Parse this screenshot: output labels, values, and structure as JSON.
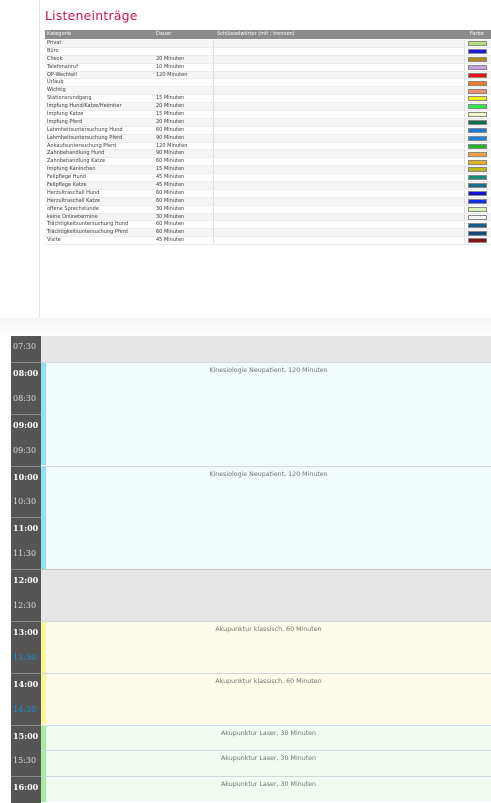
{
  "list": {
    "title": "Listeneinträge",
    "headers": {
      "kategorie": "Kategorie",
      "dauer": "Dauer",
      "schluessel": "Schlüsselwörter (mit ; trennen)",
      "farbe": "Farbe"
    },
    "rows": [
      {
        "kategorie": "Privat",
        "dauer": "",
        "color": "#b5e07a"
      },
      {
        "kategorie": "Büro",
        "dauer": "",
        "color": "#1a1ad8"
      },
      {
        "kategorie": "Check",
        "dauer": "20 Minuten",
        "color": "#b08a1a"
      },
      {
        "kategorie": "Telefonanruf",
        "dauer": "10 Minuten",
        "color": "#c9a0e6"
      },
      {
        "kategorie": "OP-Wechtell",
        "dauer": "120 Minuten",
        "color": "#ee1111"
      },
      {
        "kategorie": "Urlaub",
        "dauer": "",
        "color": "#f07a2a"
      },
      {
        "kategorie": "Wichtig",
        "dauer": "",
        "color": "#f28c6a"
      },
      {
        "kategorie": "Stationsrundgang",
        "dauer": "15 Minuten",
        "color": "#f6ee1a"
      },
      {
        "kategorie": "Impfung Hund/Katze/Heimtier",
        "dauer": "20 Minuten",
        "color": "#29e84a"
      },
      {
        "kategorie": "Impfung Katze",
        "dauer": "15 Minuten",
        "color": "#fafac8"
      },
      {
        "kategorie": "Impfung Pferd",
        "dauer": "20 Minuten",
        "color": "#0e6e4a"
      },
      {
        "kategorie": "Lahmheitsuntersuchung Hund",
        "dauer": "60 Minuten",
        "color": "#1a7ad8"
      },
      {
        "kategorie": "Lahmheitsuntersuchung Pferd",
        "dauer": "90 Minuten",
        "color": "#1a82e0"
      },
      {
        "kategorie": "Ankaufsuntersuchung Pferd",
        "dauer": "120 Minuten",
        "color": "#1ab82a"
      },
      {
        "kategorie": "Zahnbehandlung Hund",
        "dauer": "90 Minuten",
        "color": "#f2a040"
      },
      {
        "kategorie": "Zahnbehandlung Katze",
        "dauer": "60 Minuten",
        "color": "#e2b01a"
      },
      {
        "kategorie": "Impfung Kaninchen",
        "dauer": "15 Minuten",
        "color": "#c2b81a"
      },
      {
        "kategorie": "Fellpflege Hund",
        "dauer": "45 Minuten",
        "color": "#1a8a7a"
      },
      {
        "kategorie": "Fellpflege Katze",
        "dauer": "45 Minuten",
        "color": "#1a6e8a"
      },
      {
        "kategorie": "Herzultraschall Hund",
        "dauer": "60 Minuten",
        "color": "#1212d0"
      },
      {
        "kategorie": "Herzultraschall Katze",
        "dauer": "60 Minuten",
        "color": "#1230e8"
      },
      {
        "kategorie": "offene Sprechstunde",
        "dauer": "30 Minuten",
        "color": "#d8f4b8"
      },
      {
        "kategorie": "keine Onlinetermine",
        "dauer": "30 Minuten",
        "color": "#f4f4f4"
      },
      {
        "kategorie": "Trächtigkeitsuntersuchung Hund",
        "dauer": "60 Minuten",
        "color": "#1a5a8a"
      },
      {
        "kategorie": "Trächtigkeitsuntersuchung Pferd",
        "dauer": "60 Minuten",
        "color": "#124a7a"
      },
      {
        "kategorie": "Visite",
        "dauer": "45 Minuten",
        "color": "#8a1212"
      }
    ]
  },
  "calendar": {
    "times": [
      {
        "label": "07:30",
        "full": false,
        "now": false
      },
      {
        "label": "08:00",
        "full": true,
        "now": false
      },
      {
        "label": "08:30",
        "full": false,
        "now": false
      },
      {
        "label": "09:00",
        "full": true,
        "now": false
      },
      {
        "label": "09:30",
        "full": false,
        "now": false
      },
      {
        "label": "10:00",
        "full": true,
        "now": false
      },
      {
        "label": "10:30",
        "full": false,
        "now": false
      },
      {
        "label": "11:00",
        "full": true,
        "now": false
      },
      {
        "label": "11:30",
        "full": false,
        "now": false
      },
      {
        "label": "12:00",
        "full": true,
        "now": false
      },
      {
        "label": "12:30",
        "full": false,
        "now": false
      },
      {
        "label": "13:00",
        "full": true,
        "now": false
      },
      {
        "label": "13:30",
        "full": false,
        "now": true
      },
      {
        "label": "14:00",
        "full": true,
        "now": false
      },
      {
        "label": "14:30",
        "full": false,
        "now": true
      },
      {
        "label": "15:00",
        "full": true,
        "now": false
      },
      {
        "label": "15:30",
        "full": false,
        "now": false
      },
      {
        "label": "16:00",
        "full": true,
        "now": false
      }
    ],
    "appointments": [
      {
        "label": "Kinesiologie Neupatient, 120 Minuten",
        "start": "08:00",
        "minutes": 120,
        "bg": "#f1fafd",
        "strip": "#8fe0f4"
      },
      {
        "label": "Kinesiologie Neupatient, 120 Minuten",
        "start": "10:00",
        "minutes": 120,
        "bg": "#f1fafd",
        "strip": "#8fe0f4"
      },
      {
        "label": "Akupunktur klassisch, 60 Minuten",
        "start": "13:00",
        "minutes": 60,
        "bg": "#fffdea",
        "strip": "#fbf59a"
      },
      {
        "label": "Akupunktur klassisch, 60 Minuten",
        "start": "14:00",
        "minutes": 60,
        "bg": "#fffdea",
        "strip": "#fbf59a"
      },
      {
        "label": "Akupunktur Laser, 30 Minuten",
        "start": "15:00",
        "minutes": 30,
        "bg": "#f1fbf1",
        "strip": "#a6ec9e"
      },
      {
        "label": "Akupunktur Laser, 30 Minuten",
        "start": "15:30",
        "minutes": 30,
        "bg": "#f1fbf1",
        "strip": "#a6ec9e"
      },
      {
        "label": "Akupunktur Laser, 30 Minuten",
        "start": "16:00",
        "minutes": 30,
        "bg": "#f1fbf1",
        "strip": "#a6ec9e"
      }
    ],
    "closed": [
      {
        "start": "07:30",
        "minutes": 30
      },
      {
        "start": "12:00",
        "minutes": 60
      }
    ]
  }
}
